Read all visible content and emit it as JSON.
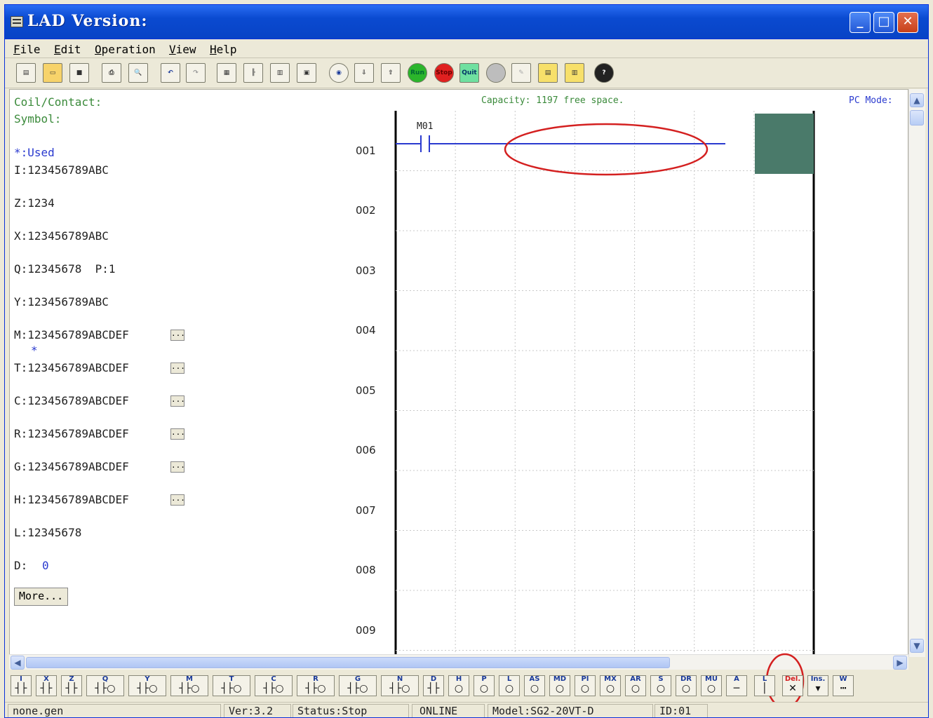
{
  "window": {
    "title": "LAD Version:"
  },
  "menu": [
    "File",
    "Edit",
    "Operation",
    "View",
    "Help"
  ],
  "toolbar": {
    "buttons": [
      "new-icon",
      "open-icon",
      "save-icon",
      "print-icon",
      "print-preview-icon",
      "undo-icon",
      "redo-icon",
      "monitor-icon",
      "ladder-icon",
      "function-block-icon",
      "display-icon",
      "connect-icon",
      "write-icon",
      "read-icon",
      "Run",
      "Stop",
      "Quit",
      "disabled-icon",
      "disabled-icon",
      "program-icon",
      "compare-icon",
      "help-icon"
    ]
  },
  "info": {
    "coil_contact": "Coil/Contact:",
    "symbol": "Symbol:",
    "capacity": "Capacity: 1197 free space.",
    "pc_mode": "PC Mode:"
  },
  "legend": {
    "used": "*:Used",
    "I": "I:123456789ABC",
    "Z": "Z:1234",
    "X": "X:123456789ABC",
    "Q": "Q:12345678  P:1",
    "Y": "Y:123456789ABC",
    "M": "M:123456789ABCDEF",
    "M_mark": "*",
    "T": "T:123456789ABCDEF",
    "C": "C:123456789ABCDEF",
    "R": "R:123456789ABCDEF",
    "G": "G:123456789ABCDEF",
    "H": "H:123456789ABCDEF",
    "L": "L:12345678",
    "D_label": "D:",
    "D_value": "0",
    "more": "More...",
    "ellipsis": "..."
  },
  "ladder": {
    "rows": [
      "001",
      "002",
      "003",
      "004",
      "005",
      "006",
      "007",
      "008",
      "009"
    ],
    "contact_label": "M01",
    "columns": 7,
    "cursor_color": "#4a7a6a",
    "line_color": "#2a3acf",
    "highlight_color": "#d42020"
  },
  "elements": [
    {
      "label": "I",
      "icon": "contact"
    },
    {
      "label": "X",
      "icon": "contact"
    },
    {
      "label": "Z",
      "icon": "contact"
    },
    {
      "label": "Q",
      "icon": "coil"
    },
    {
      "label": "Y",
      "icon": "coil"
    },
    {
      "label": "M",
      "icon": "coil"
    },
    {
      "label": "T",
      "icon": "coil"
    },
    {
      "label": "C",
      "icon": "coil"
    },
    {
      "label": "R",
      "icon": "coil"
    },
    {
      "label": "G",
      "icon": "coil"
    },
    {
      "label": "N",
      "icon": "coil"
    },
    {
      "label": "D",
      "icon": "contact"
    },
    {
      "label": "H",
      "icon": "out"
    },
    {
      "label": "P",
      "icon": "out"
    },
    {
      "label": "L",
      "icon": "out"
    },
    {
      "label": "AS",
      "icon": "out"
    },
    {
      "label": "MD",
      "icon": "out"
    },
    {
      "label": "PI",
      "icon": "out"
    },
    {
      "label": "MX",
      "icon": "out"
    },
    {
      "label": "AR",
      "icon": "out"
    },
    {
      "label": "S",
      "icon": "out"
    },
    {
      "label": "DR",
      "icon": "out"
    },
    {
      "label": "MU",
      "icon": "out"
    },
    {
      "label": "A",
      "icon": "line"
    },
    {
      "label": "L",
      "icon": "vline"
    },
    {
      "label": "Del.",
      "icon": "delete"
    },
    {
      "label": "Ins.",
      "icon": "insert"
    },
    {
      "label": "W",
      "icon": "wire"
    }
  ],
  "status": {
    "file": "none.gen",
    "version": "Ver:3.2",
    "state": "Status:Stop",
    "online": "ONLINE",
    "model": "Model:SG2-20VT-D",
    "id": "ID:01"
  }
}
